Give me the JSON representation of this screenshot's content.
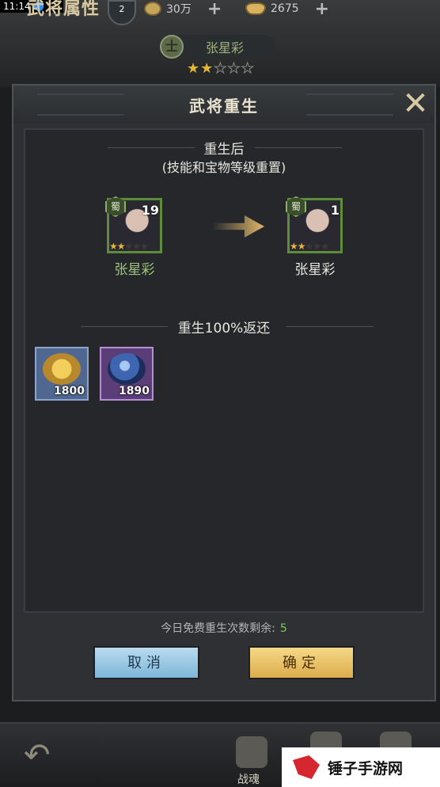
{
  "status_bar": {
    "time": "11:14"
  },
  "header": {
    "title": "武将属性",
    "badge": "2",
    "copper": "30万",
    "ingots": "2675"
  },
  "hero_banner": {
    "emblem": "士",
    "name": "张星彩",
    "stars": 2,
    "max_stars": 5
  },
  "dialog": {
    "title": "武将重生",
    "after_title": "重生后",
    "after_subtitle": "(技能和宝物等级重置)",
    "before_hero": {
      "faction": "蜀",
      "level": "19",
      "name": "张星彩",
      "stars": 2
    },
    "after_hero": {
      "faction": "蜀",
      "level": "1",
      "name": "张星彩",
      "stars": 2
    },
    "return_title": "重生100%返还",
    "items": [
      {
        "name": "copper-coins",
        "qty": "1800",
        "frame": "#6a86b0"
      },
      {
        "name": "exp-orb",
        "qty": "1890",
        "frame": "#9a6fb8"
      }
    ],
    "free_label": "今日免费重生次数剩余:",
    "free_count": "5",
    "cancel": "取消",
    "confirm": "确定"
  },
  "bottom_nav": {
    "soul_label": "战魂"
  },
  "watermark": "锤子手游网"
}
